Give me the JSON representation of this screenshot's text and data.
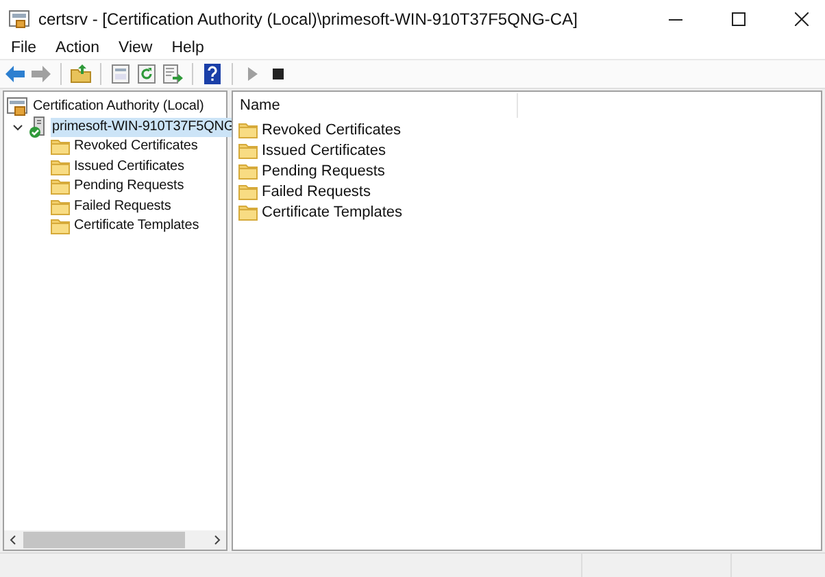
{
  "window": {
    "title": "certsrv - [Certification Authority (Local)\\primesoft-WIN-910T37F5QNG-CA]"
  },
  "menu": [
    "File",
    "Action",
    "View",
    "Help"
  ],
  "toolbar": [
    {
      "kind": "back",
      "disabled": false
    },
    {
      "kind": "forward",
      "disabled": true
    },
    {
      "kind": "sep"
    },
    {
      "kind": "up",
      "disabled": false
    },
    {
      "kind": "sep"
    },
    {
      "kind": "properties",
      "disabled": false
    },
    {
      "kind": "refresh",
      "disabled": false
    },
    {
      "kind": "export",
      "disabled": false
    },
    {
      "kind": "sep"
    },
    {
      "kind": "help",
      "disabled": false
    },
    {
      "kind": "sep"
    },
    {
      "kind": "play",
      "disabled": true
    },
    {
      "kind": "stop",
      "disabled": false
    }
  ],
  "tree": [
    {
      "label": "Certification Authority (Local)",
      "kind": "console",
      "selected": false,
      "children": [
        {
          "label": "primesoft-WIN-910T37F5QNG",
          "kind": "server",
          "selected": true,
          "expanded": true,
          "children": [
            {
              "label": "Revoked Certificates",
              "kind": "folder",
              "selected": false
            },
            {
              "label": "Issued Certificates",
              "kind": "folder",
              "selected": false
            },
            {
              "label": "Pending Requests",
              "kind": "folder",
              "selected": false
            },
            {
              "label": "Failed Requests",
              "kind": "folder",
              "selected": false
            },
            {
              "label": "Certificate Templates",
              "kind": "folder",
              "selected": false
            }
          ]
        }
      ]
    }
  ],
  "list": {
    "columns": [
      "Name"
    ],
    "rows": [
      "Revoked Certificates",
      "Issued Certificates",
      "Pending Requests",
      "Failed Requests",
      "Certificate Templates"
    ]
  }
}
